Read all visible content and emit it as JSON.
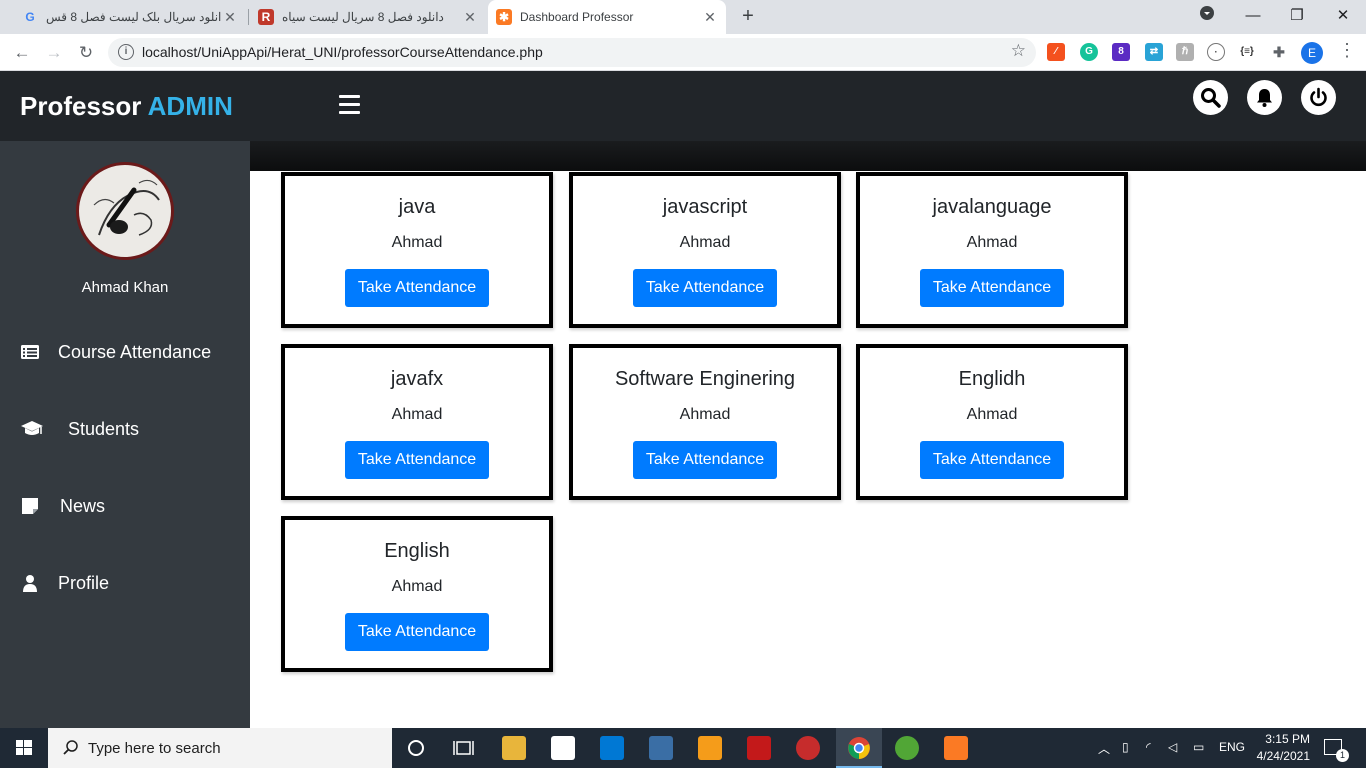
{
  "browser": {
    "tabs": [
      {
        "title": "دانلود سریال بلک لیست فصل 8 قس",
        "active": false
      },
      {
        "title": "دانلود فصل 8 سریال لیست سیاه",
        "active": false
      },
      {
        "title": "Dashboard Professor",
        "active": true
      }
    ],
    "url": "localhost/UniAppApi/Herat_UNI/professorCourseAttendance.php",
    "profile_initial": "E"
  },
  "app": {
    "brand_main": "Professor",
    "brand_accent": "ADMIN",
    "accent_color": "#35b2e8",
    "user_name": "Ahmad Khan"
  },
  "sidebar": {
    "items": [
      {
        "label": "Course Attendance",
        "icon": "list-icon"
      },
      {
        "label": "Students",
        "icon": "graduation-cap-icon"
      },
      {
        "label": "News",
        "icon": "note-icon"
      },
      {
        "label": "Profile",
        "icon": "user-icon"
      }
    ]
  },
  "courses": [
    {
      "name": "java",
      "professor": "Ahmad",
      "button": "Take Attendance"
    },
    {
      "name": "javascript",
      "professor": "Ahmad",
      "button": "Take Attendance"
    },
    {
      "name": "javalanguage",
      "professor": "Ahmad",
      "button": "Take Attendance"
    },
    {
      "name": "javafx",
      "professor": "Ahmad",
      "button": "Take Attendance"
    },
    {
      "name": "Software Enginering",
      "professor": "Ahmad",
      "button": "Take Attendance"
    },
    {
      "name": "Englidh",
      "professor": "Ahmad",
      "button": "Take Attendance"
    },
    {
      "name": "English",
      "professor": "Ahmad",
      "button": "Take Attendance"
    }
  ],
  "taskbar": {
    "search_placeholder": "Type here to search",
    "language": "ENG",
    "time": "3:15 PM",
    "date": "4/24/2021",
    "notification_count": "1"
  }
}
